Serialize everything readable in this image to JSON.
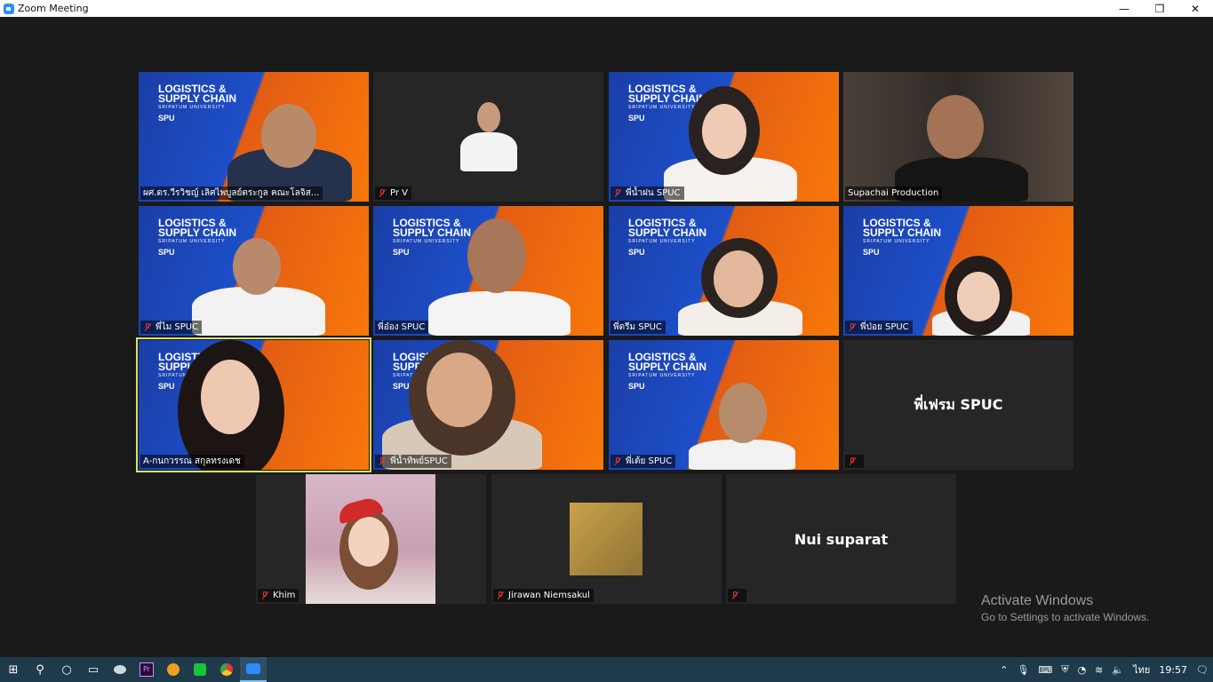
{
  "window": {
    "title": "Zoom Meeting",
    "minimize": "—",
    "restore": "❐",
    "close": "✕"
  },
  "logo": {
    "line1": "LOGISTICS &",
    "line2": "SUPPLY CHAIN",
    "line3": "SRIPATUM UNIVERSITY",
    "line4": "SPU"
  },
  "participants": [
    {
      "name": "ผศ.ดร.วีรวิชญ์ เลิศไพบูลย์ตระกูล คณะโลจิส...",
      "muted": false
    },
    {
      "name": "Pr V",
      "muted": true
    },
    {
      "name": "พี่น้ำฝน SPUC",
      "muted": true
    },
    {
      "name": "Supachai Production",
      "muted": false
    },
    {
      "name": "พี่ไม SPUC",
      "muted": true
    },
    {
      "name": "พี่อ๋อง SPUC",
      "muted": false
    },
    {
      "name": "พี่ดรีม SPUC",
      "muted": false
    },
    {
      "name": "พี่ป่อย SPUC",
      "muted": true
    },
    {
      "name": "A-กนกวรรณ สกุลทรงเดช",
      "muted": false
    },
    {
      "name": "พี่น้ำทิพย์SPUC",
      "muted": true
    },
    {
      "name": "พี่เต้ย SPUC",
      "muted": true
    },
    {
      "name": "",
      "display_name": "พี่เฟรม SPUC",
      "muted": true
    },
    {
      "name": "Khim",
      "muted": true
    },
    {
      "name": "Jirawan Niemsakul",
      "muted": true
    },
    {
      "name": "",
      "display_name": "Nui suparat",
      "muted": true
    }
  ],
  "watermark": {
    "line1": "Activate Windows",
    "line2": "Go to Settings to activate Windows."
  },
  "taskbar": {
    "time": "19:57",
    "lang": "ไทย",
    "icons": [
      "windows-logo",
      "search-icon",
      "cortana-icon",
      "task-view-icon",
      "app-icon",
      "premiere-icon",
      "app-orange-icon",
      "line-icon",
      "chrome-icon",
      "zoom-icon"
    ]
  },
  "colors": {
    "accent_active_speaker": "#d8e06a",
    "brand_blue": "#1d4fc9",
    "brand_orange": "#f7780a"
  }
}
